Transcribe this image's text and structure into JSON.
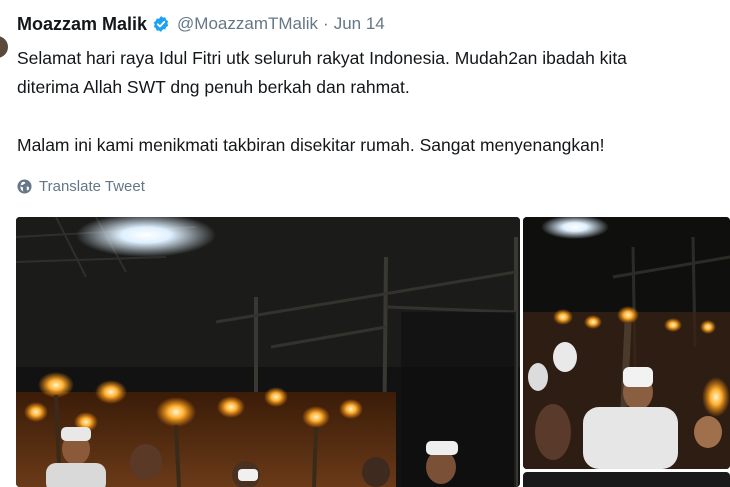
{
  "tweet": {
    "author_name": "Moazzam Malik",
    "handle": "@MoazzamTMalik",
    "separator": "·",
    "date": "Jun 14",
    "text_line_1": "Selamat hari raya Idul Fitri utk seluruh rakyat Indonesia. Mudah2an ibadah kita",
    "text_line_2": "diterima Allah SWT dng penuh berkah dan rahmat.",
    "text_line_3": "Malam ini kami menikmati takbiran disekitar rumah. Sangat menyenangkan!",
    "translate_label": "Translate Tweet"
  },
  "icons": {
    "verified": "verified-badge-icon",
    "translate": "globe-icon"
  },
  "colors": {
    "verified_blue": "#1da1f2",
    "secondary_text": "#657786",
    "primary_text": "#14171a"
  }
}
